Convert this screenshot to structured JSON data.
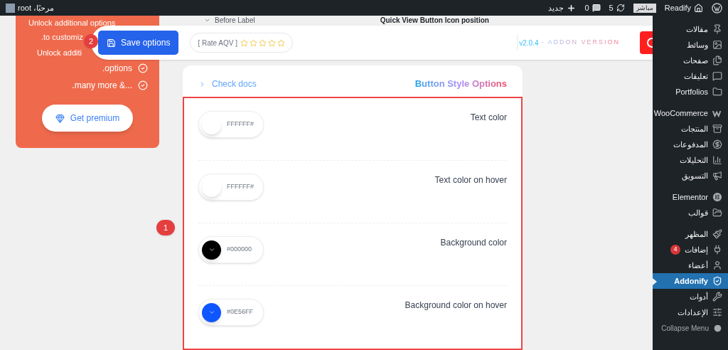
{
  "admin_bar": {
    "site_name": "Readify",
    "live_badge": "مباشر",
    "updates_count": "5",
    "comments_count": "0",
    "new_label": "جديد",
    "greeting": "مرحبًا، root"
  },
  "sidebar": {
    "items": [
      {
        "label": "مقالات",
        "selected": false
      },
      {
        "label": "وسائط",
        "selected": false
      },
      {
        "label": "صفحات",
        "selected": false
      },
      {
        "label": "تعليقات",
        "selected": false
      },
      {
        "label": "Portfolios",
        "selected": false
      },
      {
        "label": "WooCommerce",
        "selected": false
      },
      {
        "label": "المنتجات",
        "selected": false
      },
      {
        "label": "المدفوعات",
        "selected": false
      },
      {
        "label": "التحليلات",
        "selected": false
      },
      {
        "label": "التسويق",
        "selected": false
      },
      {
        "label": "Elementor",
        "selected": false
      },
      {
        "label": "قوالب",
        "selected": false
      },
      {
        "label": "المظهر",
        "selected": false
      },
      {
        "label": "إضافات",
        "selected": false,
        "badge": "4"
      },
      {
        "label": "أعضاء",
        "selected": false
      },
      {
        "label": "Addonify",
        "selected": true
      },
      {
        "label": "أدوات",
        "selected": false
      },
      {
        "label": "الإعدادات",
        "selected": false
      }
    ],
    "collapse_label": "Collapse Menu"
  },
  "premium_card": {
    "lines": [
      "Unlock additional options",
      ".to customiz",
      "Unlock additi"
    ],
    "features": [
      ".options",
      ".many more &..."
    ],
    "button": "Get premium"
  },
  "behind_toolbar": {
    "dropdown_value": "Before Label",
    "section_title": "Quick View Button Icon position"
  },
  "toolbar": {
    "save_button": "Save options",
    "rate_label": "[ Rate AQV ]",
    "version": "v2.0.4",
    "version_suffix": "- ADDON VERSION"
  },
  "panel": {
    "docs_link": "Check docs",
    "title": "Button Style Options",
    "fields": [
      {
        "label": "Text color",
        "value": "FFFFFF#",
        "color": "#ffffff",
        "chevron": false
      },
      {
        "label": "Text color on hover",
        "value": "FFFFFF#",
        "color": "#ffffff",
        "chevron": false
      },
      {
        "label": "Background color",
        "value": "#000000",
        "color": "#000000",
        "chevron": true
      },
      {
        "label": "Background color on hover",
        "value": "#0E56FF",
        "color": "#0e56ff",
        "chevron": true
      }
    ]
  },
  "annotations": [
    "1",
    "2"
  ]
}
